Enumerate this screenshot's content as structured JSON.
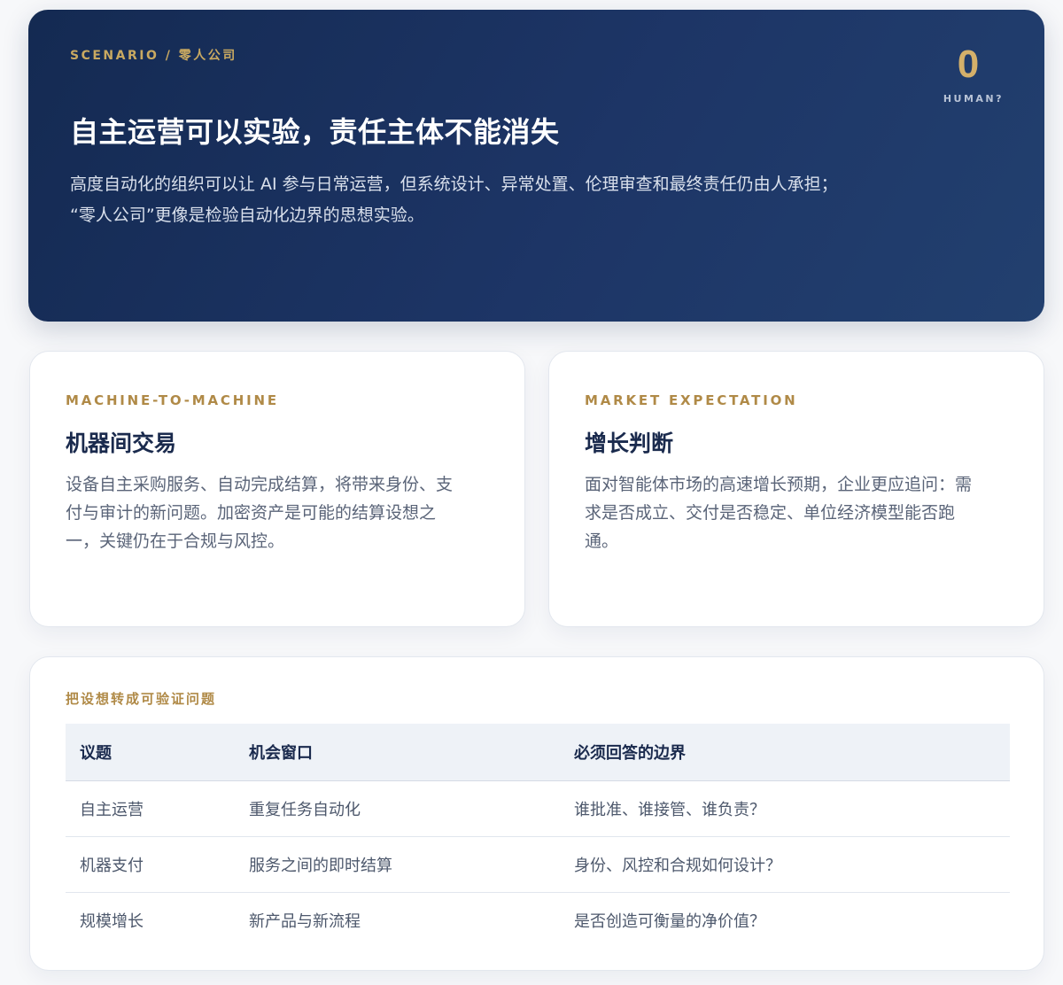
{
  "hero": {
    "tag": "SCENARIO / 零人公司",
    "stat_value": "0",
    "stat_label": "HUMAN?",
    "title": "自主运营可以实验，责任主体不能消失",
    "description_line1": "高度自动化的组织可以让 AI 参与日常运营，但系统设计、异常处置、伦理审查和最终责任仍由人承担；",
    "description_line2": "“零人公司”更像是检验自动化边界的思想实验。"
  },
  "cards": [
    {
      "kicker": "MACHINE-TO-MACHINE",
      "title": "机器间交易",
      "body_line1": "设备自主采购服务、自动完成结算，将带来身份、支",
      "body_line2": "付与审计的新问题。加密资产是可能的结算设想之",
      "body_line3": "一，关键仍在于合规与风控。"
    },
    {
      "kicker": "MARKET EXPECTATION",
      "title": "增长判断",
      "body_line1": "面对智能体市场的高速增长预期，企业更应追问：需",
      "body_line2": "求是否成立、交付是否稳定、单位经济模型能否跑",
      "body_line3": "通。"
    }
  ],
  "table_panel": {
    "kicker": "把设想转成可验证问题",
    "headers": [
      "议题",
      "机会窗口",
      "必须回答的边界"
    ],
    "rows": [
      [
        "自主运营",
        "重复任务自动化",
        "谁批准、谁接管、谁负责？"
      ],
      [
        "机器支付",
        "服务之间的即时结算",
        "身份、风控和合规如何设计？"
      ],
      [
        "规模增长",
        "新产品与新流程",
        "是否创造可衡量的净价值？"
      ]
    ]
  },
  "colors": {
    "hero_bg": "#1d3566",
    "accent_gold": "#c9a961",
    "heading_navy": "#1a2a4d",
    "table_header_bg": "#eef2f7"
  }
}
